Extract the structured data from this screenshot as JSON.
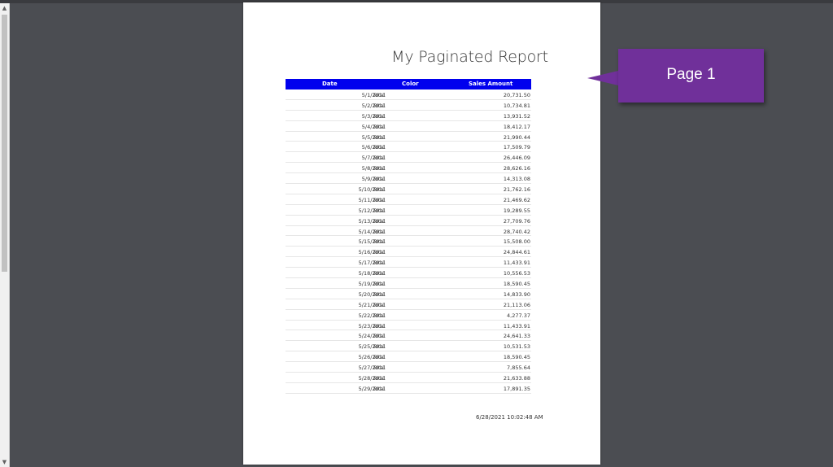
{
  "viewer": {
    "scroll_up_glyph": "▲",
    "scroll_down_glyph": "▼"
  },
  "report": {
    "title": "My Paginated Report",
    "columns": {
      "date": "Date",
      "color": "Color",
      "sales": "Sales Amount"
    },
    "header_color": "#0000ee",
    "rows": [
      {
        "date": "5/1/2011",
        "label": "Total",
        "amount": "20,731.50"
      },
      {
        "date": "5/2/2011",
        "label": "Total",
        "amount": "10,734.81"
      },
      {
        "date": "5/3/2011",
        "label": "Total",
        "amount": "13,931.52"
      },
      {
        "date": "5/4/2011",
        "label": "Total",
        "amount": "18,412.17"
      },
      {
        "date": "5/5/2011",
        "label": "Total",
        "amount": "21,990.44"
      },
      {
        "date": "5/6/2011",
        "label": "Total",
        "amount": "17,509.79"
      },
      {
        "date": "5/7/2011",
        "label": "Total",
        "amount": "26,446.09"
      },
      {
        "date": "5/8/2011",
        "label": "Total",
        "amount": "28,626.16"
      },
      {
        "date": "5/9/2011",
        "label": "Total",
        "amount": "14,313.08"
      },
      {
        "date": "5/10/2011",
        "label": "Total",
        "amount": "21,762.16"
      },
      {
        "date": "5/11/2011",
        "label": "Total",
        "amount": "21,469.62"
      },
      {
        "date": "5/12/2011",
        "label": "Total",
        "amount": "19,289.55"
      },
      {
        "date": "5/13/2011",
        "label": "Total",
        "amount": "27,709.76"
      },
      {
        "date": "5/14/2011",
        "label": "Total",
        "amount": "28,740.42"
      },
      {
        "date": "5/15/2011",
        "label": "Total",
        "amount": "15,508.00"
      },
      {
        "date": "5/16/2011",
        "label": "Total",
        "amount": "24,844.61"
      },
      {
        "date": "5/17/2011",
        "label": "Total",
        "amount": "11,433.91"
      },
      {
        "date": "5/18/2011",
        "label": "Total",
        "amount": "10,556.53"
      },
      {
        "date": "5/19/2011",
        "label": "Total",
        "amount": "18,590.45"
      },
      {
        "date": "5/20/2011",
        "label": "Total",
        "amount": "14,833.90"
      },
      {
        "date": "5/21/2011",
        "label": "Total",
        "amount": "21,113.06"
      },
      {
        "date": "5/22/2011",
        "label": "Total",
        "amount": "4,277.37"
      },
      {
        "date": "5/23/2011",
        "label": "Total",
        "amount": "11,433.91"
      },
      {
        "date": "5/24/2011",
        "label": "Total",
        "amount": "24,641.33"
      },
      {
        "date": "5/25/2011",
        "label": "Total",
        "amount": "10,531.53"
      },
      {
        "date": "5/26/2011",
        "label": "Total",
        "amount": "18,590.45"
      },
      {
        "date": "5/27/2011",
        "label": "Total",
        "amount": "7,855.64"
      },
      {
        "date": "5/28/2011",
        "label": "Total",
        "amount": "21,633.88"
      },
      {
        "date": "5/29/2011",
        "label": "Total",
        "amount": "17,891.35"
      }
    ],
    "timestamp": "6/28/2021 10:02:48 AM"
  },
  "callout": {
    "label": "Page 1",
    "color": "#70309a"
  }
}
